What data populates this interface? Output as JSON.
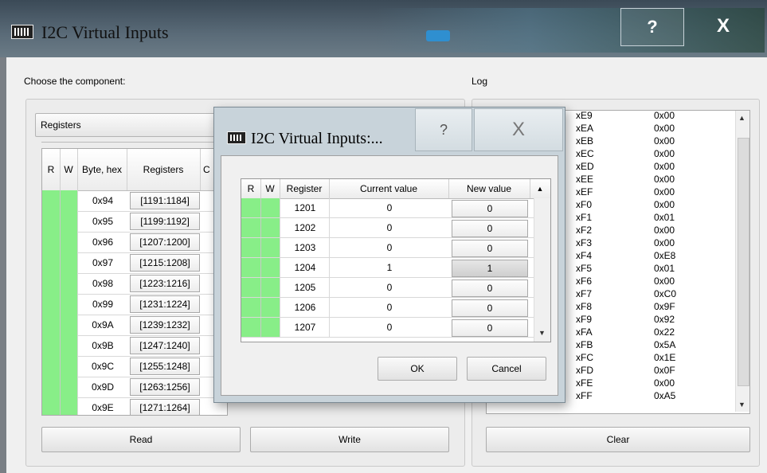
{
  "window": {
    "title": "I2C Virtual Inputs",
    "help_label": "?",
    "close_label": "X"
  },
  "left": {
    "choose_label": "Choose the component:",
    "component_selected": "Registers",
    "headers": {
      "r": "R",
      "w": "W",
      "byte": "Byte, hex",
      "registers": "Registers",
      "partial": "C"
    },
    "rows": [
      {
        "byte": "0x94",
        "reg": "[1191:1184]"
      },
      {
        "byte": "0x95",
        "reg": "[1199:1192]"
      },
      {
        "byte": "0x96",
        "reg": "[1207:1200]"
      },
      {
        "byte": "0x97",
        "reg": "[1215:1208]"
      },
      {
        "byte": "0x98",
        "reg": "[1223:1216]"
      },
      {
        "byte": "0x99",
        "reg": "[1231:1224]"
      },
      {
        "byte": "0x9A",
        "reg": "[1239:1232]"
      },
      {
        "byte": "0x9B",
        "reg": "[1247:1240]"
      },
      {
        "byte": "0x9C",
        "reg": "[1255:1248]"
      },
      {
        "byte": "0x9D",
        "reg": "[1263:1256]"
      },
      {
        "byte": "0x9E",
        "reg": "[1271:1264]"
      }
    ],
    "read_label": "Read",
    "write_label": "Write"
  },
  "log": {
    "label": "Log",
    "rows": [
      {
        "a": "xE9",
        "v": "0x00"
      },
      {
        "a": "xEA",
        "v": "0x00"
      },
      {
        "a": "xEB",
        "v": "0x00"
      },
      {
        "a": "xEC",
        "v": "0x00"
      },
      {
        "a": "xED",
        "v": "0x00"
      },
      {
        "a": "xEE",
        "v": "0x00"
      },
      {
        "a": "xEF",
        "v": "0x00"
      },
      {
        "a": "xF0",
        "v": "0x00"
      },
      {
        "a": "xF1",
        "v": "0x01"
      },
      {
        "a": "xF2",
        "v": "0x00"
      },
      {
        "a": "xF3",
        "v": "0x00"
      },
      {
        "a": "xF4",
        "v": "0xE8"
      },
      {
        "a": "xF5",
        "v": "0x01"
      },
      {
        "a": "xF6",
        "v": "0x00"
      },
      {
        "a": "xF7",
        "v": "0xC0"
      },
      {
        "a": "xF8",
        "v": "0x9F"
      },
      {
        "a": "xF9",
        "v": "0x92"
      },
      {
        "a": "xFA",
        "v": "0x22"
      },
      {
        "a": "xFB",
        "v": "0x5A"
      },
      {
        "a": "xFC",
        "v": "0x1E"
      },
      {
        "a": "xFD",
        "v": "0x0F"
      },
      {
        "a": "xFE",
        "v": "0x00"
      },
      {
        "a": "xFF",
        "v": "0xA5"
      }
    ],
    "clear_label": "Clear"
  },
  "dialog": {
    "title": "I2C Virtual Inputs:...",
    "help_label": "?",
    "close_label": "X",
    "headers": {
      "r": "R",
      "w": "W",
      "register": "Register",
      "current": "Current value",
      "new": "New value"
    },
    "rows": [
      {
        "reg": "1201",
        "cur": "0",
        "new": "0"
      },
      {
        "reg": "1202",
        "cur": "0",
        "new": "0"
      },
      {
        "reg": "1203",
        "cur": "0",
        "new": "0"
      },
      {
        "reg": "1204",
        "cur": "1",
        "new": "1"
      },
      {
        "reg": "1205",
        "cur": "0",
        "new": "0"
      },
      {
        "reg": "1206",
        "cur": "0",
        "new": "0"
      },
      {
        "reg": "1207",
        "cur": "0",
        "new": "0"
      }
    ],
    "ok_label": "OK",
    "cancel_label": "Cancel"
  }
}
